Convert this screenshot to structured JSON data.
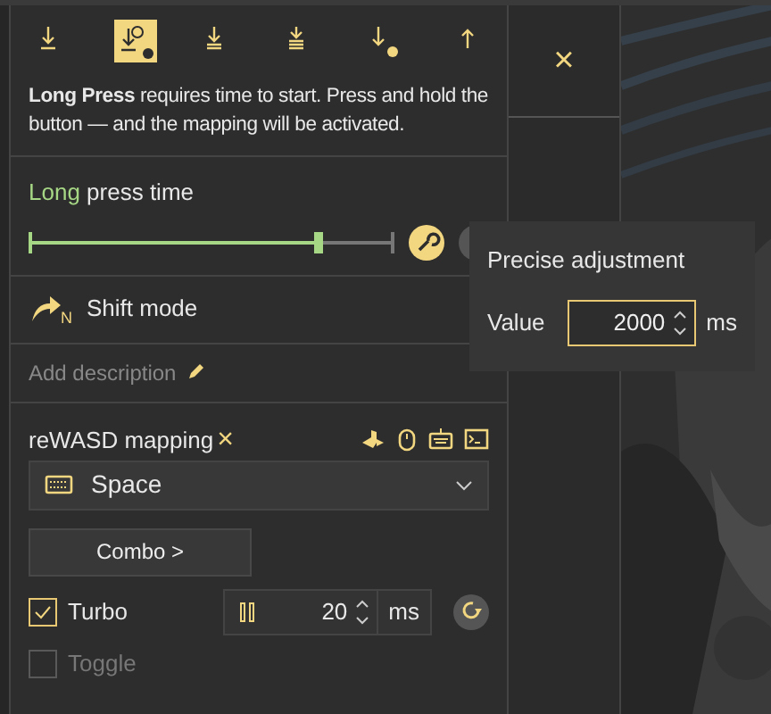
{
  "toolbar": [
    {
      "selected": false
    },
    {
      "selected": true
    },
    {
      "selected": false
    },
    {
      "selected": false
    },
    {
      "selected": false
    },
    {
      "selected": false
    }
  ],
  "description": "**Long Press** requires time to start. Press and hold the button — and the mapping will be activated.",
  "close_label": "×",
  "press_time": {
    "label_highlight": "Long",
    "label_rest": "press time",
    "level": 0.79
  },
  "precise_adjustment": {
    "title": "Precise adjustment",
    "label": "Value",
    "value": "2000",
    "unit": "ms"
  },
  "shift_mode": {
    "label": "Shift mode",
    "badge": "N"
  },
  "add_description": "Add description",
  "mapping": {
    "title": "reWASD mapping",
    "remove": "×",
    "key": "Space",
    "combo_button": "Combo >"
  },
  "options": [
    {
      "kind": "turbo",
      "label": "Turbo",
      "checked": true,
      "disabled": false,
      "value": "20",
      "unit": "ms"
    },
    {
      "kind": "toggle",
      "label": "Toggle",
      "checked": false,
      "disabled": true
    }
  ]
}
